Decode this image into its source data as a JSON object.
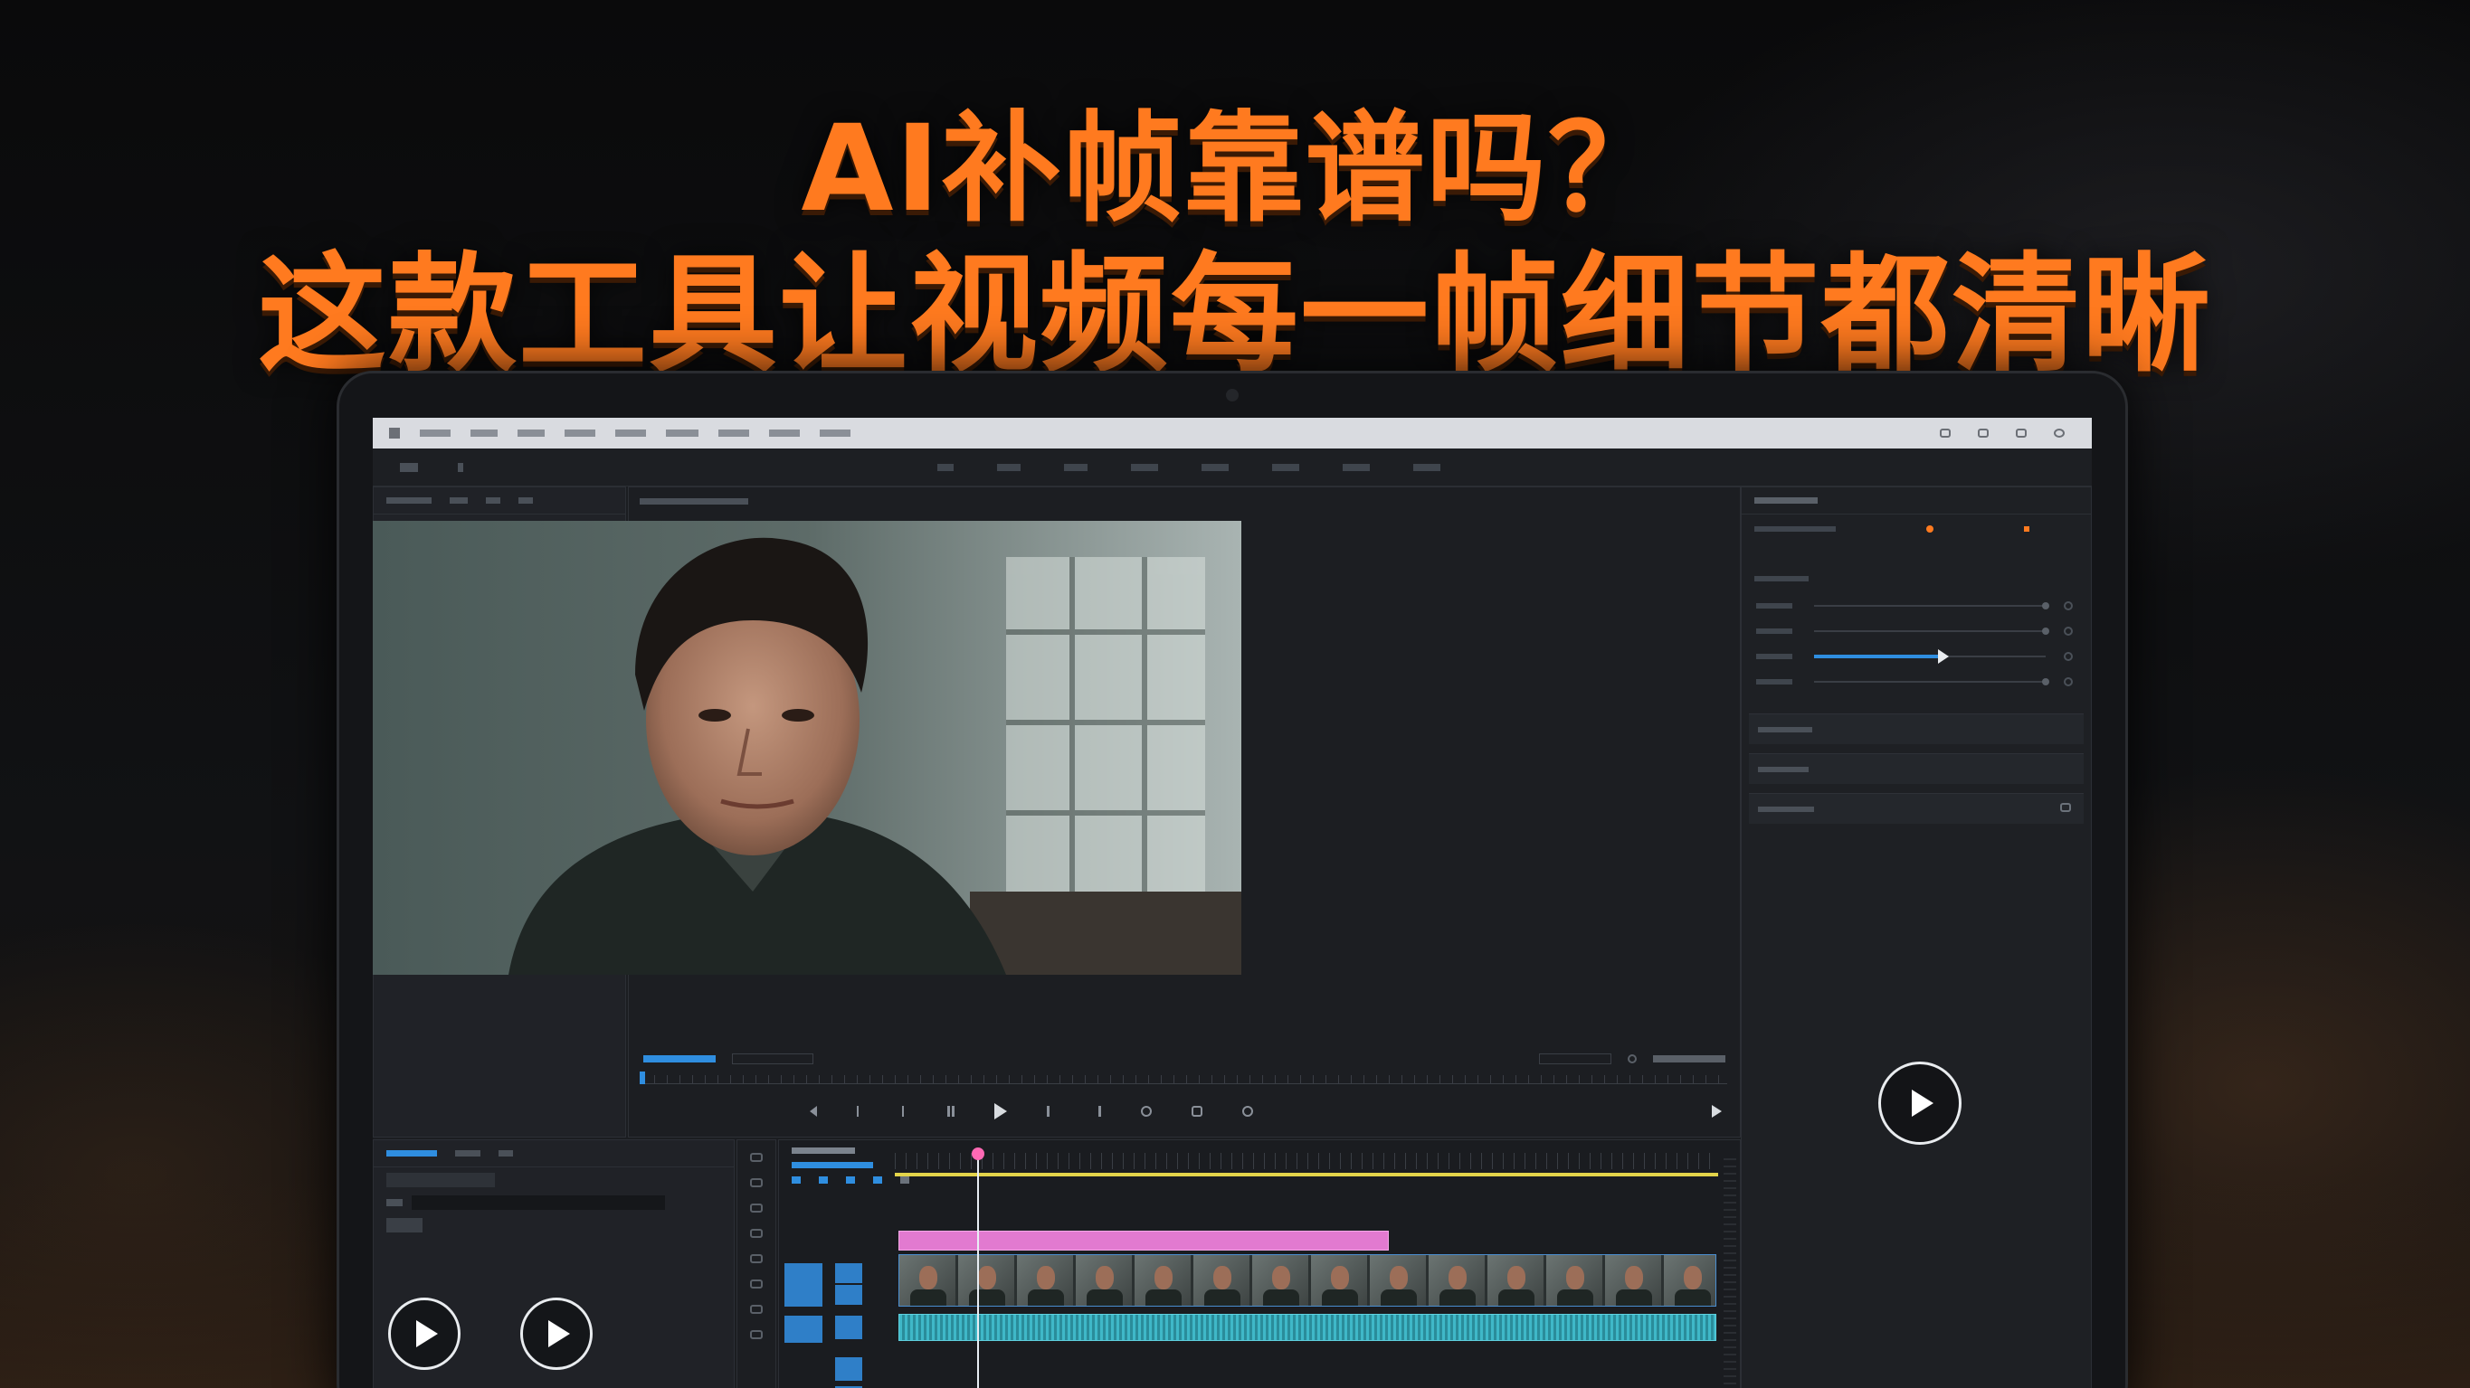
{
  "headline": {
    "line1": "AI补帧靠谱吗？",
    "line2": "这款工具让视频每一帧细节都清晰"
  },
  "colors": {
    "headline": "#ff7a1f",
    "accent_blue": "#2f8ee0",
    "clip_pink": "#e27ad0",
    "audio_cyan": "#3fb8c8",
    "playhead": "#ff69b4",
    "work_area": "#e3d44a"
  },
  "icons": {
    "play": "play-icon",
    "rewind": "step-back-icon",
    "forward": "step-forward-icon",
    "fullscreen": "fullscreen-icon",
    "settings": "gear-icon"
  },
  "timeline": {
    "playhead_fraction": 0.1
  },
  "effects": {
    "slider_values": [
      0.0,
      0.0,
      0.55,
      0.0
    ]
  }
}
